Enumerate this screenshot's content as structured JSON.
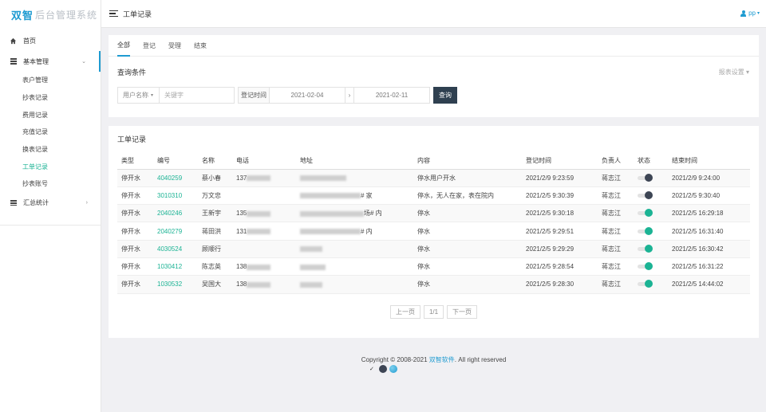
{
  "app": {
    "brand_main": "双智",
    "brand_sub": "后台管理系统"
  },
  "header": {
    "title": "工单记录",
    "user": "pp",
    "user_caret": "▾"
  },
  "sidebar": {
    "home": "首页",
    "basic": "基本管理",
    "basic_items": [
      "表户管理",
      "抄表记录",
      "费用记录",
      "充值记录",
      "换表记录",
      "工单记录",
      "抄表账号"
    ],
    "stats": "汇总统计"
  },
  "tabs": [
    "全部",
    "登记",
    "受理",
    "结束"
  ],
  "query": {
    "title": "查询条件",
    "report_setting": "报表设置 ▾",
    "field_select": "用户名称",
    "keyword_placeholder": "关键字",
    "date_label": "登记时间",
    "date_from": "2021-02-04",
    "arrow": "›",
    "date_to": "2021-02-11",
    "search_button": "查询"
  },
  "records": {
    "title": "工单记录",
    "columns": [
      "类型",
      "编号",
      "名称",
      "电话",
      "地址",
      "内容",
      "登记时间",
      "负责人",
      "状态",
      "结束时间"
    ],
    "rows": [
      {
        "type": "停开水",
        "code": "4040259",
        "name": "蔡小春",
        "phone": "137",
        "addr_suffix": "",
        "content": "停水用户开水",
        "reg_time": "2021/2/9 9:23:59",
        "owner": "蒋志江",
        "status": "pending",
        "end_time": "2021/2/9 9:24:00"
      },
      {
        "type": "停开水",
        "code": "3010310",
        "name": "万文忠",
        "phone": "",
        "addr_suffix": "# 家",
        "content": "停水，无人在家，表在院内",
        "reg_time": "2021/2/5 9:30:39",
        "owner": "蒋志江",
        "status": "pending",
        "end_time": "2021/2/5 9:30:40"
      },
      {
        "type": "停开水",
        "code": "2040246",
        "name": "王新宇",
        "phone": "135",
        "addr_suffix": "场# 内",
        "content": "停水",
        "reg_time": "2021/2/5 9:30:18",
        "owner": "蒋志江",
        "status": "done",
        "end_time": "2021/2/5 16:29:18"
      },
      {
        "type": "停开水",
        "code": "2040279",
        "name": "蒋田洪",
        "phone": "131",
        "addr_suffix": "# 内",
        "content": "停水",
        "reg_time": "2021/2/5 9:29:51",
        "owner": "蒋志江",
        "status": "done",
        "end_time": "2021/2/5 16:31:40"
      },
      {
        "type": "停开水",
        "code": "4030524",
        "name": "顾顺行",
        "phone": "",
        "addr_suffix": "",
        "content": "停水",
        "reg_time": "2021/2/5 9:29:29",
        "owner": "蒋志江",
        "status": "done",
        "end_time": "2021/2/5 16:30:42"
      },
      {
        "type": "停开水",
        "code": "1030412",
        "name": "陈志英",
        "phone": "138",
        "addr_suffix": "",
        "content": "停水",
        "reg_time": "2021/2/5 9:28:54",
        "owner": "蒋志江",
        "status": "done",
        "end_time": "2021/2/5 16:31:22"
      },
      {
        "type": "停开水",
        "code": "1030532",
        "name": "吴国大",
        "phone": "138",
        "addr_suffix": "",
        "content": "停水",
        "reg_time": "2021/2/5 9:28:30",
        "owner": "蒋志江",
        "status": "done",
        "end_time": "2021/2/5 14:44:02"
      }
    ]
  },
  "pager": {
    "prev": "上一页",
    "page": "1/1",
    "next": "下一页"
  },
  "footer": {
    "prefix": "Copyright © 2008-2021 ",
    "brand": "双智软件",
    "suffix": ". All right reserved",
    "check": "✓"
  },
  "colors": {
    "accent": "#1f9bd1",
    "green": "#1bb394",
    "dark": "#2f4050",
    "pending": "#3d4554",
    "theme_dark": "#3d4554",
    "theme_blue": "#1f9bd1"
  }
}
